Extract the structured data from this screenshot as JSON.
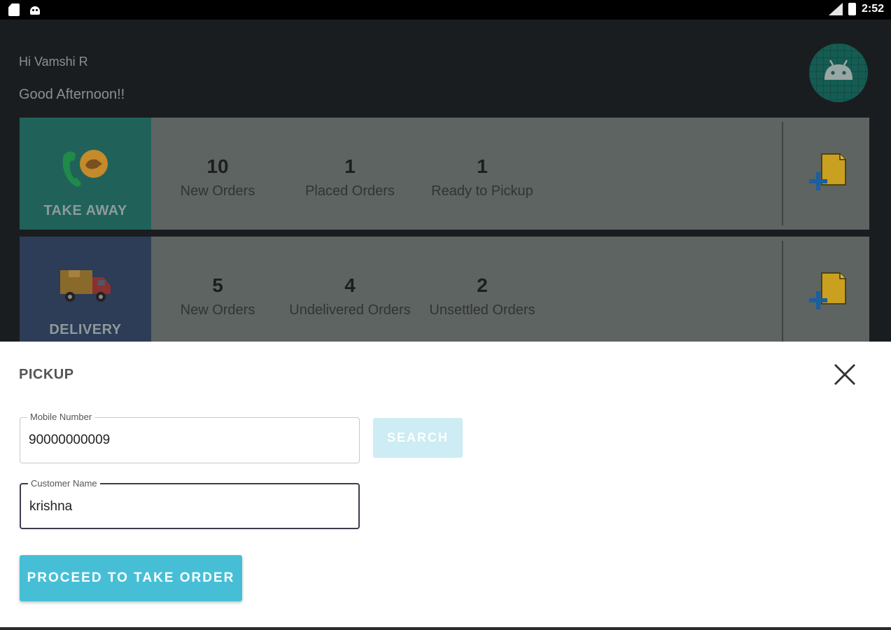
{
  "status_bar": {
    "time": "2:52",
    "icons": [
      "sd-card-icon",
      "android-debug-icon",
      "no-signal-icon",
      "battery-icon"
    ]
  },
  "greeting": {
    "hello": "Hi Vamshi R",
    "message": "Good Afternoon!!"
  },
  "cards": {
    "take_away": {
      "label": "TAKE AWAY",
      "stats": [
        {
          "value": "10",
          "label": "New Orders"
        },
        {
          "value": "1",
          "label": "Placed Orders"
        },
        {
          "value": "1",
          "label": "Ready to Pickup"
        }
      ]
    },
    "delivery": {
      "label": "DELIVERY",
      "stats": [
        {
          "value": "5",
          "label": "New Orders"
        },
        {
          "value": "4",
          "label": "Undelivered Orders"
        },
        {
          "value": "2",
          "label": "Unsettled Orders"
        }
      ]
    }
  },
  "sheet": {
    "title": "PICKUP",
    "mobile_label": "Mobile Number",
    "mobile_value": "90000000009",
    "name_label": "Customer Name",
    "name_value": "krishna",
    "search_label": "SEARCH",
    "proceed_label": "PROCEED TO TAKE ORDER"
  },
  "colors": {
    "accent": "#46bfd6",
    "take_away_tile": "#20625a",
    "delivery_tile": "#2d3c57",
    "search_disabled": "#cdecf3"
  }
}
